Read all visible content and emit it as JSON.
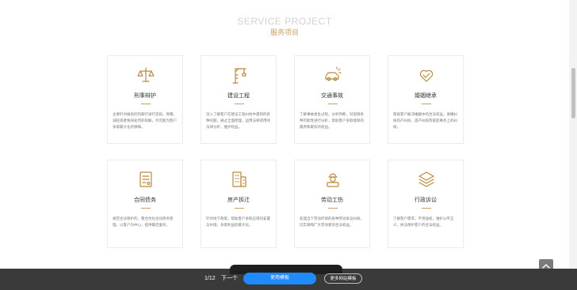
{
  "section": {
    "title_en": "SERVICE PROJECT",
    "title_cn": "服务项目"
  },
  "cards": [
    {
      "title": "刑事辩护",
      "icon": "scales-icon",
      "desc": "主要针对被指控的罪行进行充辩，目睹，减轻或者免除处罚的辩解，尽可能为客户争取最大化的保障。"
    },
    {
      "title": "建设工程",
      "icon": "crane-icon",
      "desc": "深入了解客户在建设工程纠纷中遇到的各种问题，通过全面梳理，运用法律适用的法律分析，维护权益。"
    },
    {
      "title": "交通事故",
      "icon": "car-crash-icon",
      "desc": "了解事故发生过程，分析判断，对案情各种可能性进行分析，帮助客户争取能够的最原和最有的权益。"
    },
    {
      "title": "婚姻继承",
      "icon": "heart-hands-icon",
      "desc": "帮助客户解决婚姻中的合法权益，离婚纠纷的产纠纷，遗产纠纷等家庭事务上的纠纷。"
    },
    {
      "title": "合同债务",
      "icon": "contract-icon",
      "desc": "规范合法保护的，整合优化合同债务管理，以客户为中心，提供最佳服务。"
    },
    {
      "title": "房产拆迁",
      "icon": "building-icon",
      "desc": "针对地下政策，帮助客户争取应得的安置与补偿，争取利益的最大化。"
    },
    {
      "title": "劳动工伤",
      "icon": "worker-icon",
      "desc": "处理当下劳动环境的各种劳动争议纠纷，切实保障广大劳动者的合法权益。"
    },
    {
      "title": "行政诉讼",
      "icon": "layers-icon",
      "desc": "了解客户需求，不畏强权，维护公平正义，依法保护客户的合法权益。"
    }
  ],
  "toolbar": {
    "page_indicator": "1/12",
    "next_label": "下一个",
    "use_template_label": "使用模板",
    "more_templates_label": "更多网站模板"
  },
  "colors": {
    "accent": "#c9a063",
    "primary_button": "#1f8bff",
    "bar": "#3a3a3a"
  }
}
